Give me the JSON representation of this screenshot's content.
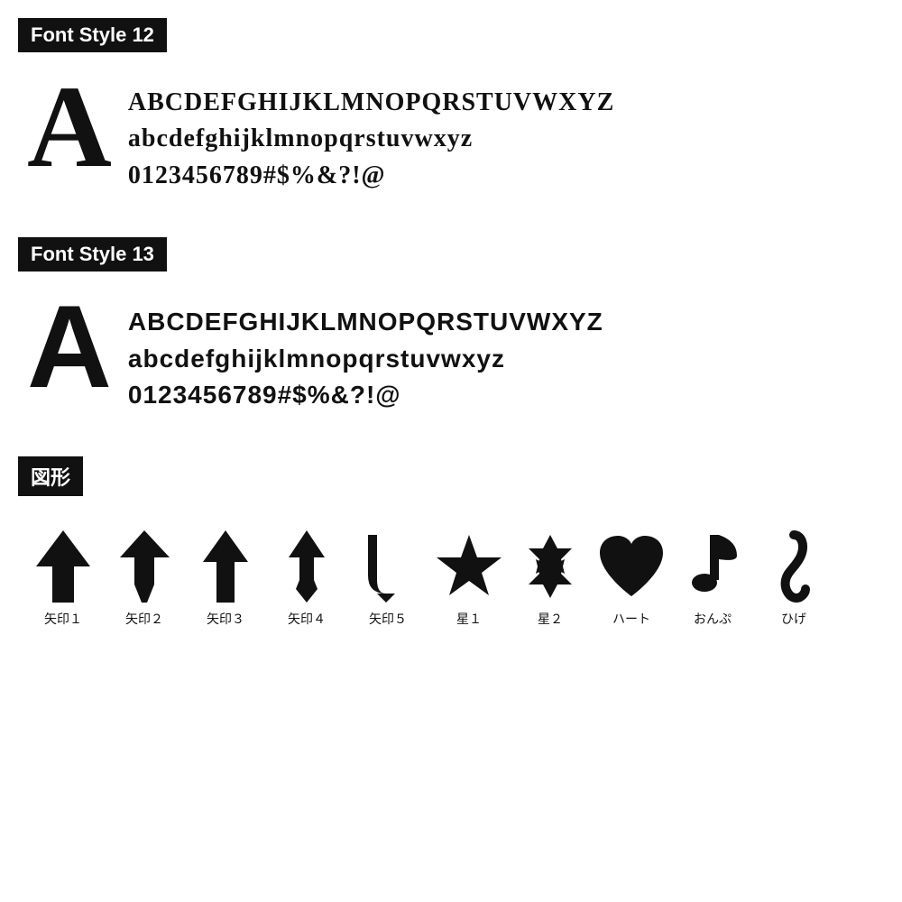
{
  "font12": {
    "header": "Font Style 12",
    "bigLetter": "A",
    "lines": [
      "ABCDEFGHIJKLMNOPQRSTUVWXYZ",
      "abcdefghijklmnopqrstuvwxyz",
      "0123456789#$%&?!@"
    ]
  },
  "font13": {
    "header": "Font Style 13",
    "bigLetter": "A",
    "lines": [
      "ABCDEFGHIJKLMNOPQRSTUVWXYZ",
      "abcdefghijklmnopqrstuvwxyz",
      "0123456789#$%&?!@"
    ]
  },
  "shapes": {
    "header": "図形",
    "items": [
      {
        "label": "矢印１",
        "icon": "arrow1"
      },
      {
        "label": "矢印２",
        "icon": "arrow2"
      },
      {
        "label": "矢印３",
        "icon": "arrow3"
      },
      {
        "label": "矢印４",
        "icon": "arrow4"
      },
      {
        "label": "矢印５",
        "icon": "arrow5"
      },
      {
        "label": "星１",
        "icon": "star1"
      },
      {
        "label": "星２",
        "icon": "star2"
      },
      {
        "label": "ハート",
        "icon": "heart"
      },
      {
        "label": "おんぷ",
        "icon": "music"
      },
      {
        "label": "ひげ",
        "icon": "mustache"
      }
    ]
  }
}
